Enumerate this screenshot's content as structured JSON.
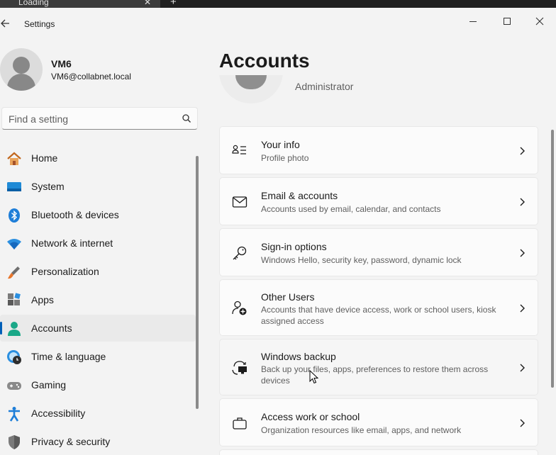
{
  "browser": {
    "tab_title": "Loading",
    "tab_close": "✕",
    "new_tab": "+"
  },
  "window": {
    "title": "Settings",
    "back_icon": "arrow-left-icon"
  },
  "user": {
    "name": "VM6",
    "email": "VM6@collabnet.local",
    "role": "Administrator"
  },
  "search": {
    "placeholder": "Find a setting"
  },
  "nav": {
    "items": [
      {
        "label": "Home",
        "icon": "home-icon"
      },
      {
        "label": "System",
        "icon": "system-icon"
      },
      {
        "label": "Bluetooth & devices",
        "icon": "bluetooth-icon"
      },
      {
        "label": "Network & internet",
        "icon": "wifi-icon"
      },
      {
        "label": "Personalization",
        "icon": "brush-icon"
      },
      {
        "label": "Apps",
        "icon": "apps-icon"
      },
      {
        "label": "Accounts",
        "icon": "accounts-icon",
        "selected": true
      },
      {
        "label": "Time & language",
        "icon": "globe-clock-icon"
      },
      {
        "label": "Gaming",
        "icon": "gamepad-icon"
      },
      {
        "label": "Accessibility",
        "icon": "accessibility-icon"
      },
      {
        "label": "Privacy & security",
        "icon": "shield-icon"
      }
    ]
  },
  "page": {
    "title": "Accounts"
  },
  "cards": [
    {
      "title": "Your info",
      "desc": "Profile photo",
      "icon": "person-info-icon"
    },
    {
      "title": "Email & accounts",
      "desc": "Accounts used by email, calendar, and contacts",
      "icon": "mail-icon"
    },
    {
      "title": "Sign-in options",
      "desc": "Windows Hello, security key, password, dynamic lock",
      "icon": "key-icon"
    },
    {
      "title": "Other Users",
      "desc": "Accounts that have device access, work or school users, kiosk assigned access",
      "icon": "person-add-icon"
    },
    {
      "title": "Windows backup",
      "desc": "Back up your files, apps, preferences to restore them across devices",
      "icon": "backup-icon"
    },
    {
      "title": "Access work or school",
      "desc": "Organization resources like email, apps, and network",
      "icon": "briefcase-icon"
    }
  ],
  "colors": {
    "accent": "#005fb8",
    "background": "#f3f3f3",
    "card": "#fbfbfb"
  }
}
